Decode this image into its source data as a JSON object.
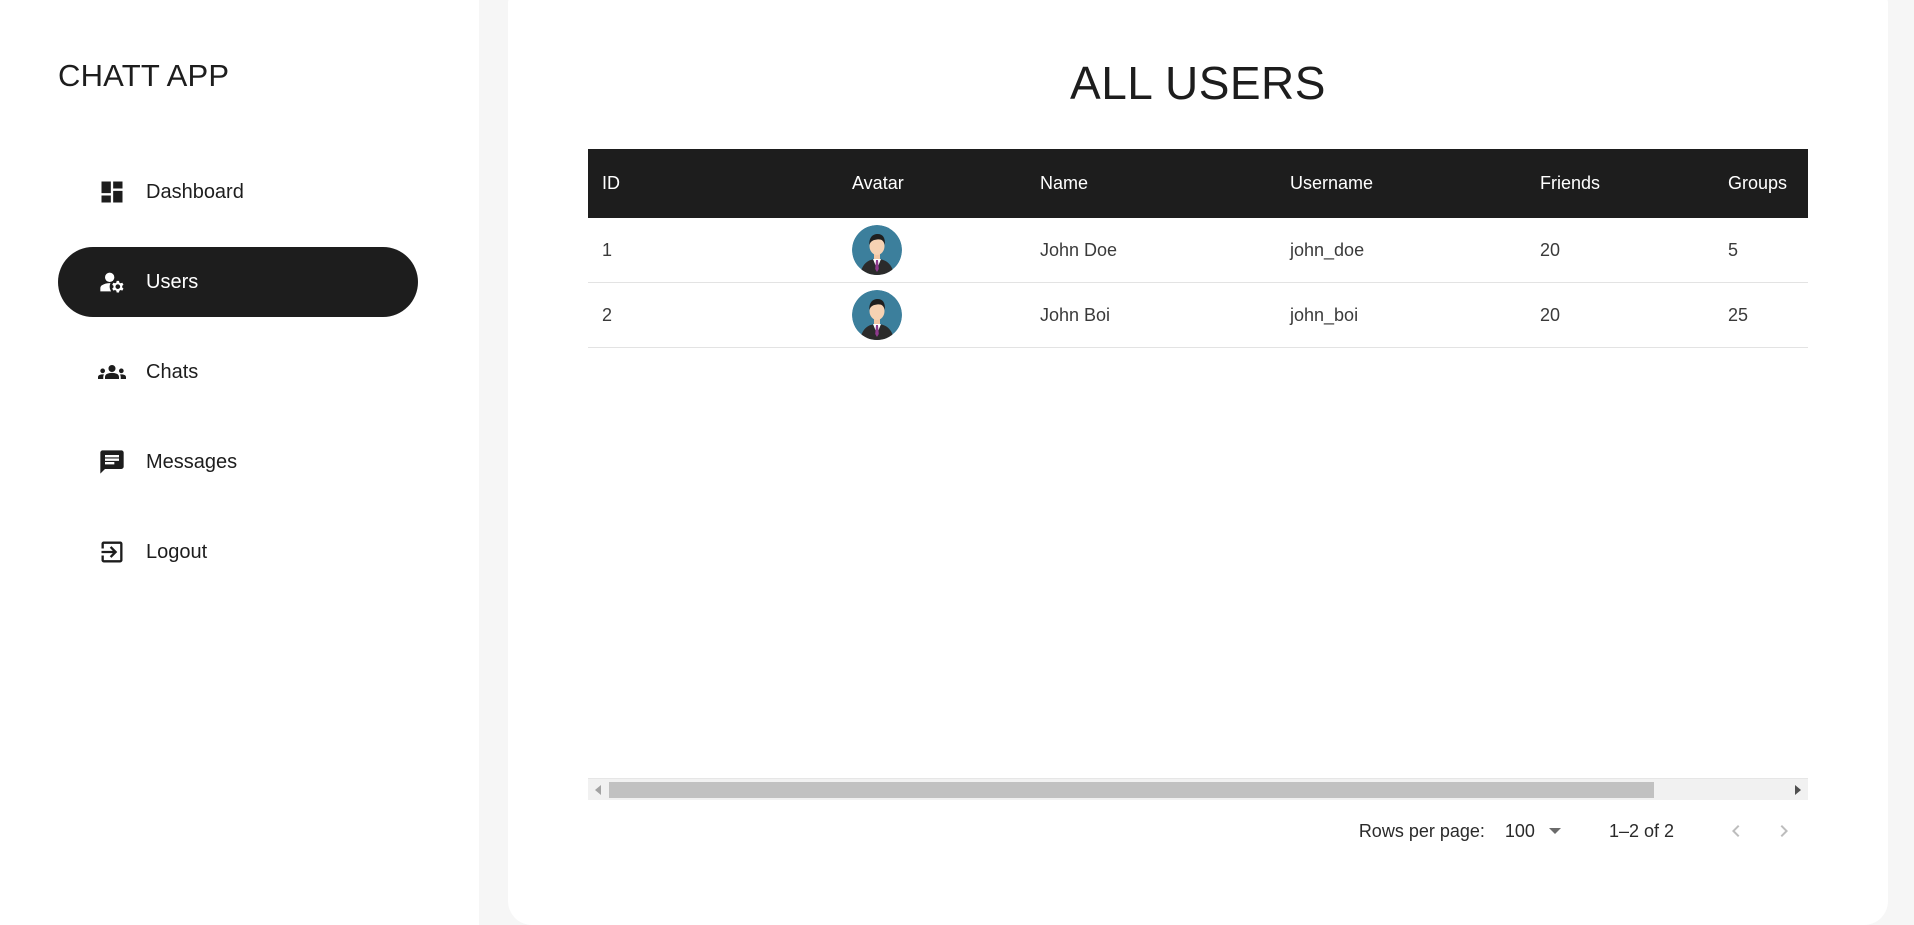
{
  "app": {
    "brand": "CHATT APP"
  },
  "sidebar": {
    "items": [
      {
        "label": "Dashboard",
        "icon": "dashboard-icon",
        "active": false
      },
      {
        "label": "Users",
        "icon": "user-settings-icon",
        "active": true
      },
      {
        "label": "Chats",
        "icon": "group-icon",
        "active": false
      },
      {
        "label": "Messages",
        "icon": "message-icon",
        "active": false
      },
      {
        "label": "Logout",
        "icon": "logout-icon",
        "active": false
      }
    ]
  },
  "main": {
    "title": "ALL USERS",
    "table": {
      "columns": [
        "ID",
        "Avatar",
        "Name",
        "Username",
        "Friends",
        "Groups"
      ],
      "rows": [
        {
          "id": "1",
          "avatar": "user-avatar-icon",
          "name": "John Doe",
          "username": "john_doe",
          "friends": "20",
          "groups": "5"
        },
        {
          "id": "2",
          "avatar": "user-avatar-icon",
          "name": "John Boi",
          "username": "john_boi",
          "friends": "20",
          "groups": "25"
        }
      ]
    },
    "pagination": {
      "rows_per_page_label": "Rows per page:",
      "rows_per_page_value": "100",
      "range": "1–2 of 2"
    }
  },
  "colors": {
    "page_background": "#f6f6f6",
    "accent_dark": "#1d1d1d",
    "row_border": "#e3e3e3",
    "disabled_icon": "#bdbdbd"
  }
}
